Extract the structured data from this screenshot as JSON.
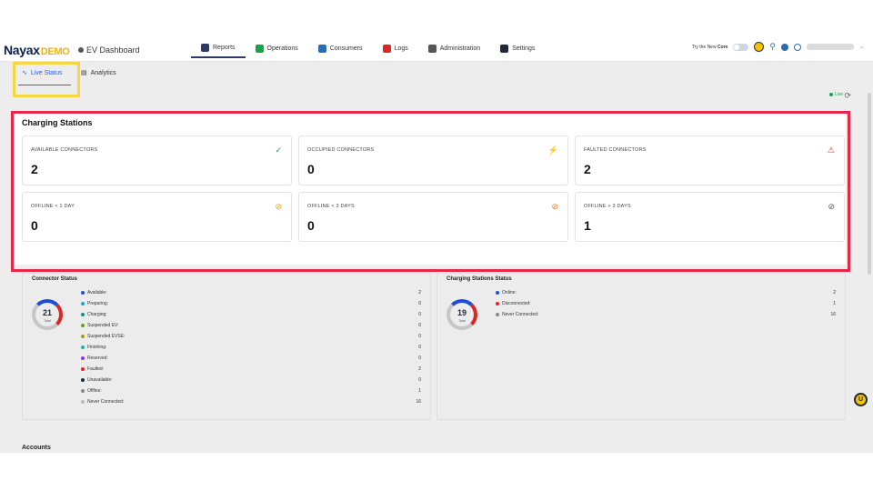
{
  "brand": {
    "name": "Nayax",
    "suffix": "DEMO",
    "app_title": "EV Dashboard"
  },
  "nav": [
    {
      "label": "Reports",
      "color": "#2b3a67"
    },
    {
      "label": "Operations",
      "color": "#16a34a"
    },
    {
      "label": "Consumers",
      "color": "#2b6cb0"
    },
    {
      "label": "Logs",
      "color": "#dc2626"
    },
    {
      "label": "Administration",
      "color": "#555555"
    },
    {
      "label": "Settings",
      "color": "#1f2937"
    }
  ],
  "top_right": {
    "try_label": "Try the New",
    "core_label": "Core"
  },
  "subnav": {
    "live_status": "Live Status",
    "analytics": "Analytics"
  },
  "live_indicator": "Live",
  "charging_stations": {
    "title": "Charging Stations",
    "stats": [
      {
        "label": "AVAILABLE CONNECTORS",
        "value": "2",
        "icon": "check-circle-icon",
        "color": "#16a34a"
      },
      {
        "label": "OCCUPIED CONNECTORS",
        "value": "0",
        "icon": "lightning-icon",
        "color": "#60a5fa"
      },
      {
        "label": "FAULTED CONNECTORS",
        "value": "2",
        "icon": "warning-icon",
        "color": "#dc2626"
      },
      {
        "label": "OFFLINE < 1 DAY",
        "value": "0",
        "icon": "wifi-off-icon",
        "color": "#f59e0b"
      },
      {
        "label": "OFFLINE < 3 DAYS",
        "value": "0",
        "icon": "wifi-off-icon",
        "color": "#f97316"
      },
      {
        "label": "OFFLINE > 3 DAYS",
        "value": "1",
        "icon": "wifi-off-icon",
        "color": "#555555"
      }
    ]
  },
  "connector_status": {
    "title": "Connector Status",
    "total": "21",
    "total_label": "Total",
    "rows": [
      {
        "label": "Available:",
        "value": "2",
        "color": "#1d4ed8"
      },
      {
        "label": "Preparing:",
        "value": "0",
        "color": "#0ea5e9"
      },
      {
        "label": "Charging:",
        "value": "0",
        "color": "#0d9488"
      },
      {
        "label": "Suspended EV:",
        "value": "0",
        "color": "#65a30d"
      },
      {
        "label": "Suspended EVSE:",
        "value": "0",
        "color": "#a3a30d"
      },
      {
        "label": "Finishing:",
        "value": "0",
        "color": "#14b8a6"
      },
      {
        "label": "Reserved:",
        "value": "0",
        "color": "#9333ea"
      },
      {
        "label": "Faulted:",
        "value": "2",
        "color": "#dc2626"
      },
      {
        "label": "Unavailable:",
        "value": "0",
        "color": "#1f2937"
      },
      {
        "label": "Offline:",
        "value": "1",
        "color": "#888888"
      },
      {
        "label": "Never Connected:",
        "value": "16",
        "color": "#bbbbbb"
      }
    ]
  },
  "stations_status": {
    "title": "Charging Stations Status",
    "total": "19",
    "total_label": "Total",
    "rows": [
      {
        "label": "Online:",
        "value": "2",
        "color": "#1d4ed8"
      },
      {
        "label": "Disconnected:",
        "value": "1",
        "color": "#dc2626"
      },
      {
        "label": "Never Connected:",
        "value": "16",
        "color": "#888888"
      }
    ]
  },
  "accounts_title": "Accounts"
}
